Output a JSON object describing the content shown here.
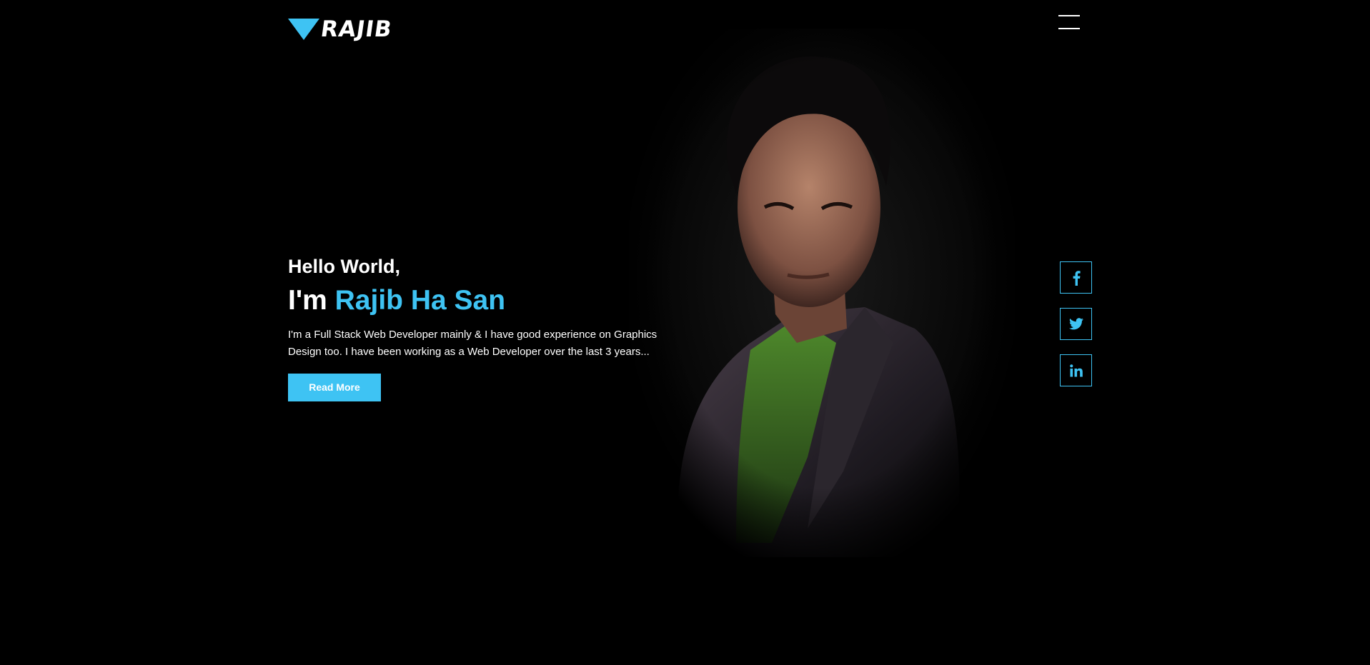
{
  "header": {
    "logo_text": "RAJIB",
    "logo_icon": "triangle-logo-icon",
    "menu_icon": "hamburger-menu-icon"
  },
  "hero": {
    "greeting": "Hello World,",
    "name_prefix": "I'm",
    "name": "Rajib Ha San",
    "intro": "I'm a Full Stack Web Developer mainly & I have good experience on Graphics Design too. I have been working as a Web Developer over the last 3 years...",
    "cta_label": "Read More"
  },
  "socials": [
    {
      "name": "facebook",
      "icon": "facebook-icon"
    },
    {
      "name": "twitter",
      "icon": "twitter-icon"
    },
    {
      "name": "linkedin",
      "icon": "linkedin-icon"
    }
  ],
  "colors": {
    "background": "#000000",
    "accent": "#3ec3f3",
    "text": "#ffffff"
  }
}
